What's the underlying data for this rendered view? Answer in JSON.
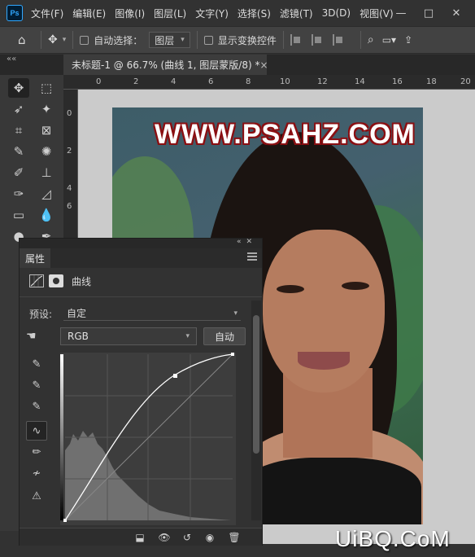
{
  "menubar": {
    "logo": "Ps",
    "items": [
      "文件(F)",
      "编辑(E)",
      "图像(I)",
      "图层(L)",
      "文字(Y)",
      "选择(S)",
      "滤镜(T)",
      "3D(D)",
      "视图(V)"
    ],
    "window_buttons": [
      "—",
      "□",
      "✕"
    ]
  },
  "options": {
    "auto_select_label": "自动选择：",
    "layer_select": "图层",
    "show_transform_label": "显示变换控件"
  },
  "document": {
    "tab_title": "未标题-1 @ 66.7% (曲线 1, 图层蒙版/8) *",
    "close": "×",
    "watermark": "WWW.PSAHZ.COM"
  },
  "rulers": {
    "h": [
      "0",
      "2",
      "4",
      "6",
      "8",
      "10",
      "12",
      "14",
      "16",
      "18",
      "20"
    ],
    "v": [
      "0",
      "2",
      "4",
      "6"
    ]
  },
  "properties": {
    "tab": "属性",
    "adjustment_name": "曲线",
    "preset_label": "预设:",
    "preset_value": "自定",
    "channel": "RGB",
    "auto_button": "自动"
  },
  "corner_watermark": "UiBQ.CoM",
  "colors": {
    "panel_bg": "#323232",
    "toolbar_bg": "#383838",
    "canvas_bg": "#cbcbcb",
    "watermark_stroke": "#8a0f12",
    "histogram": "#707070"
  }
}
